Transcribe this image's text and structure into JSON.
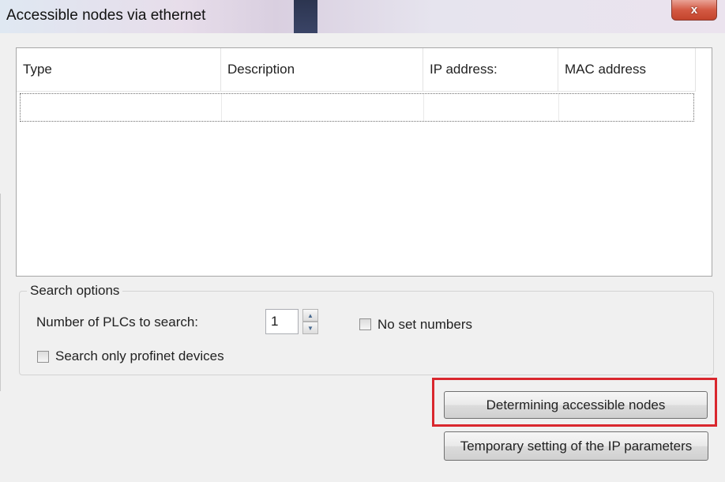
{
  "window": {
    "title": "Accessible nodes via ethernet",
    "close_label": "x"
  },
  "listview": {
    "columns": [
      "Type",
      "Description",
      "IP address:",
      "MAC address"
    ],
    "rows": []
  },
  "search_options": {
    "legend": "Search options",
    "plc_count_label": "Number of PLCs to search:",
    "plc_count_value": "1",
    "spin_up": "▲",
    "spin_down": "▼",
    "no_set_numbers_label": "No set numbers",
    "no_set_numbers_checked": false,
    "profinet_only_label": "Search only profinet devices",
    "profinet_only_checked": false
  },
  "buttons": {
    "determine": "Determining accessible nodes",
    "temporary_ip": "Temporary setting of the IP parameters"
  },
  "colors": {
    "highlight": "#d9272e",
    "close_button": "#c9503a"
  }
}
